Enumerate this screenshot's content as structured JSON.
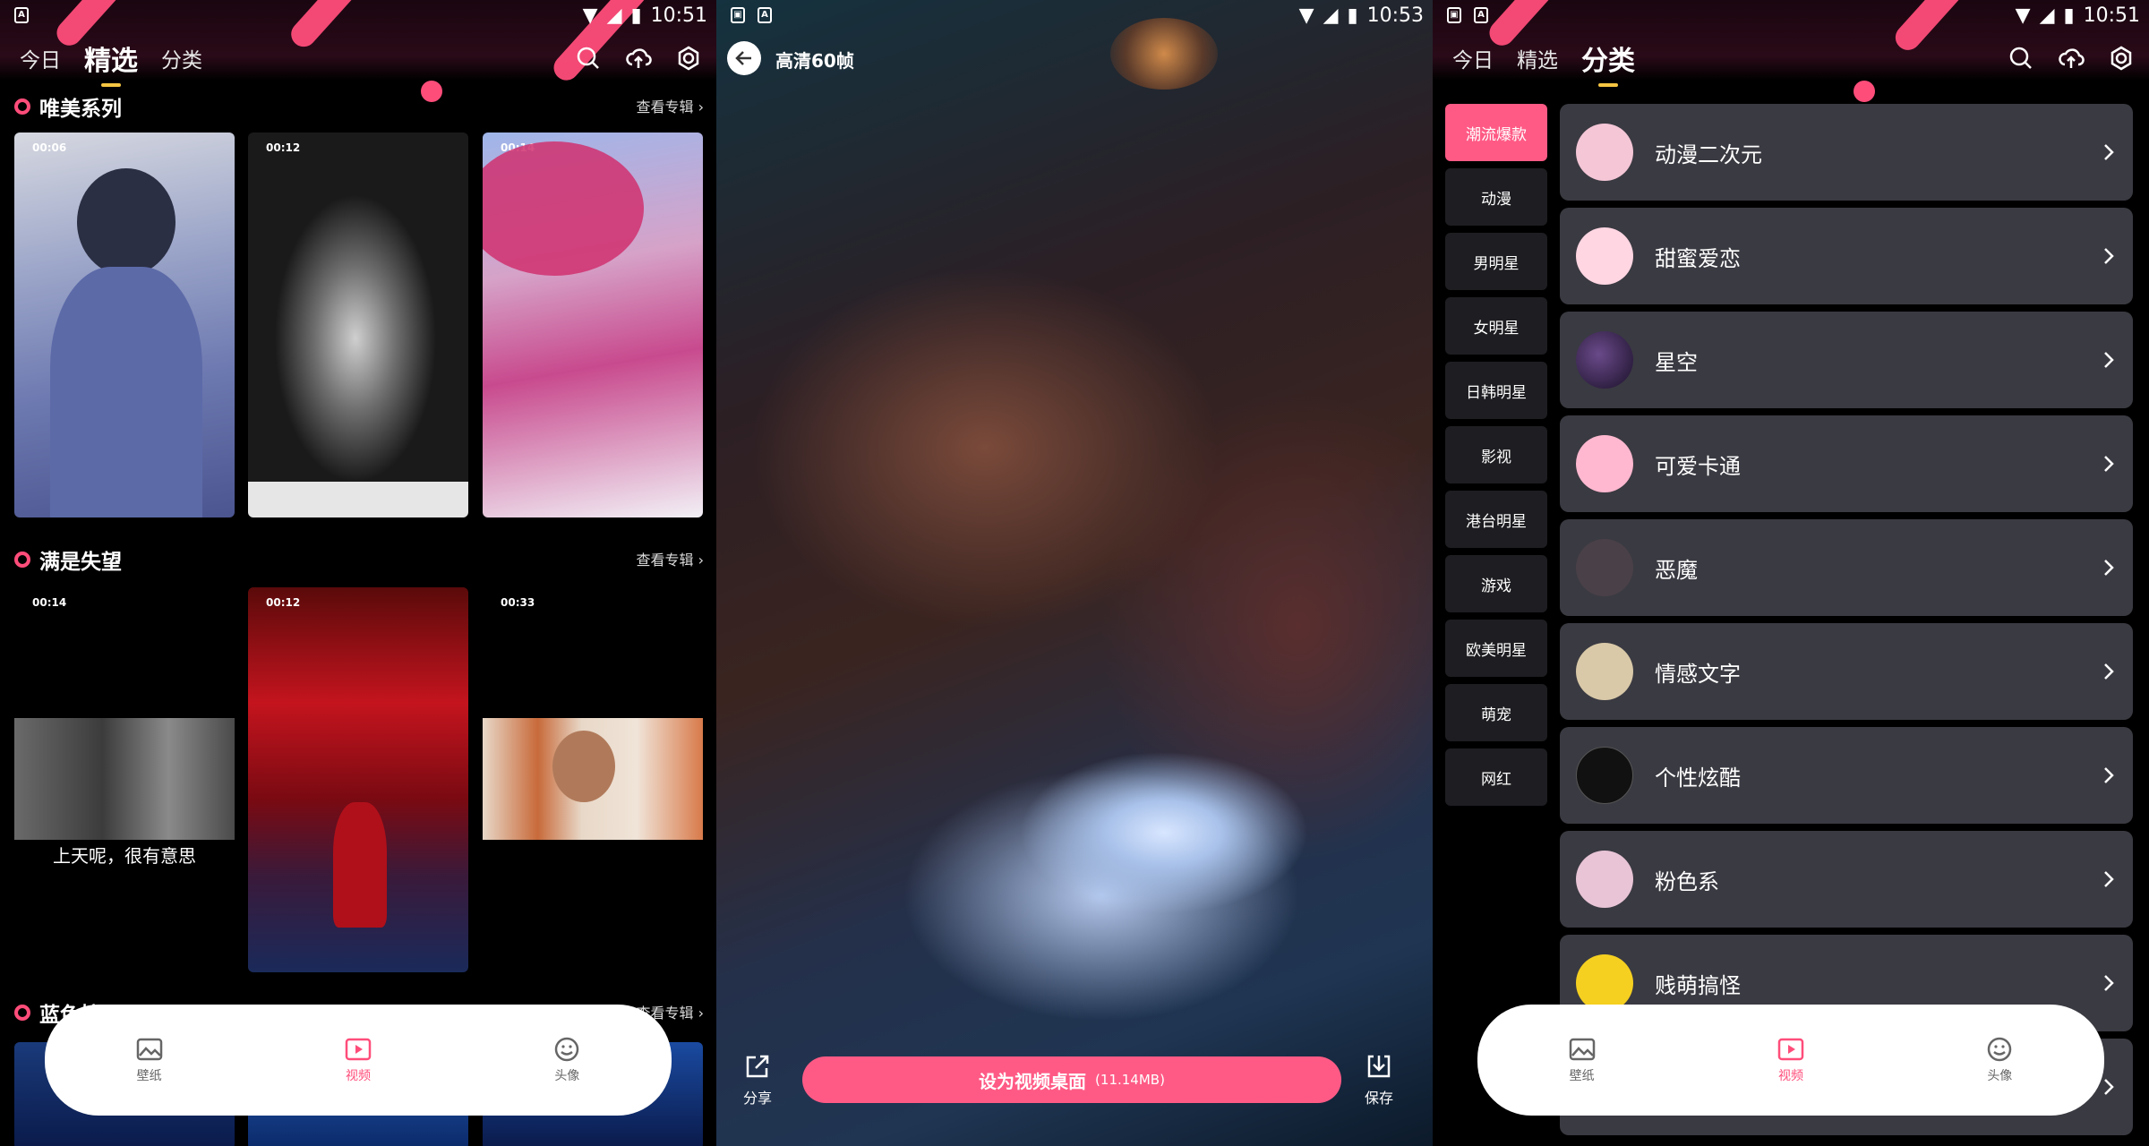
{
  "status_times": [
    "10:51",
    "10:53",
    "10:51"
  ],
  "panel1": {
    "tabs": [
      "今日",
      "精选",
      "分类"
    ],
    "active_tab": 1,
    "sections": [
      {
        "title": "唯美系列",
        "more": "查看专辑",
        "durations": [
          "00:06",
          "00:12",
          "00:14"
        ]
      },
      {
        "title": "满是失望",
        "more": "查看专辑",
        "durations": [
          "00:14",
          "00:12",
          "00:33"
        ],
        "caption": "上天呢，很有意思"
      },
      {
        "title": "蓝色控",
        "more": "查看专辑"
      }
    ]
  },
  "bottom_nav": [
    {
      "label": "壁纸",
      "icon": "wallpaper-icon"
    },
    {
      "label": "视频",
      "icon": "video-icon",
      "active": true
    },
    {
      "label": "头像",
      "icon": "avatar-face-icon"
    }
  ],
  "panel2": {
    "title": "高清60帧",
    "share": "分享",
    "set_button": "设为视频桌面",
    "size": "(11.14MB)",
    "save": "保存"
  },
  "panel3": {
    "tabs": [
      "今日",
      "精选",
      "分类"
    ],
    "active_tab": 2,
    "categories": [
      "潮流爆款",
      "动漫",
      "男明星",
      "女明星",
      "日韩明星",
      "影视",
      "港台明星",
      "游戏",
      "欧美明星",
      "萌宠",
      "网红"
    ],
    "items": [
      {
        "label": "动漫二次元",
        "color": "#f4c6d6"
      },
      {
        "label": "甜蜜爱恋",
        "color": "#ffd6e2"
      },
      {
        "label": "星空",
        "color": "#2a1a3a"
      },
      {
        "label": "可爱卡通",
        "color": "#ffb8cf"
      },
      {
        "label": "恶魔",
        "color": "#4a4048"
      },
      {
        "label": "情感文字",
        "color": "#d9c9a8"
      },
      {
        "label": "个性炫酷",
        "color": "#111111"
      },
      {
        "label": "粉色系",
        "color": "#e8c4d6"
      },
      {
        "label": "贱萌搞怪",
        "color": "#f5d020"
      }
    ]
  },
  "colors": {
    "accent": "#ff4d7a",
    "row_bg": "#3a3a42",
    "tab_underline": "#f5c542"
  }
}
